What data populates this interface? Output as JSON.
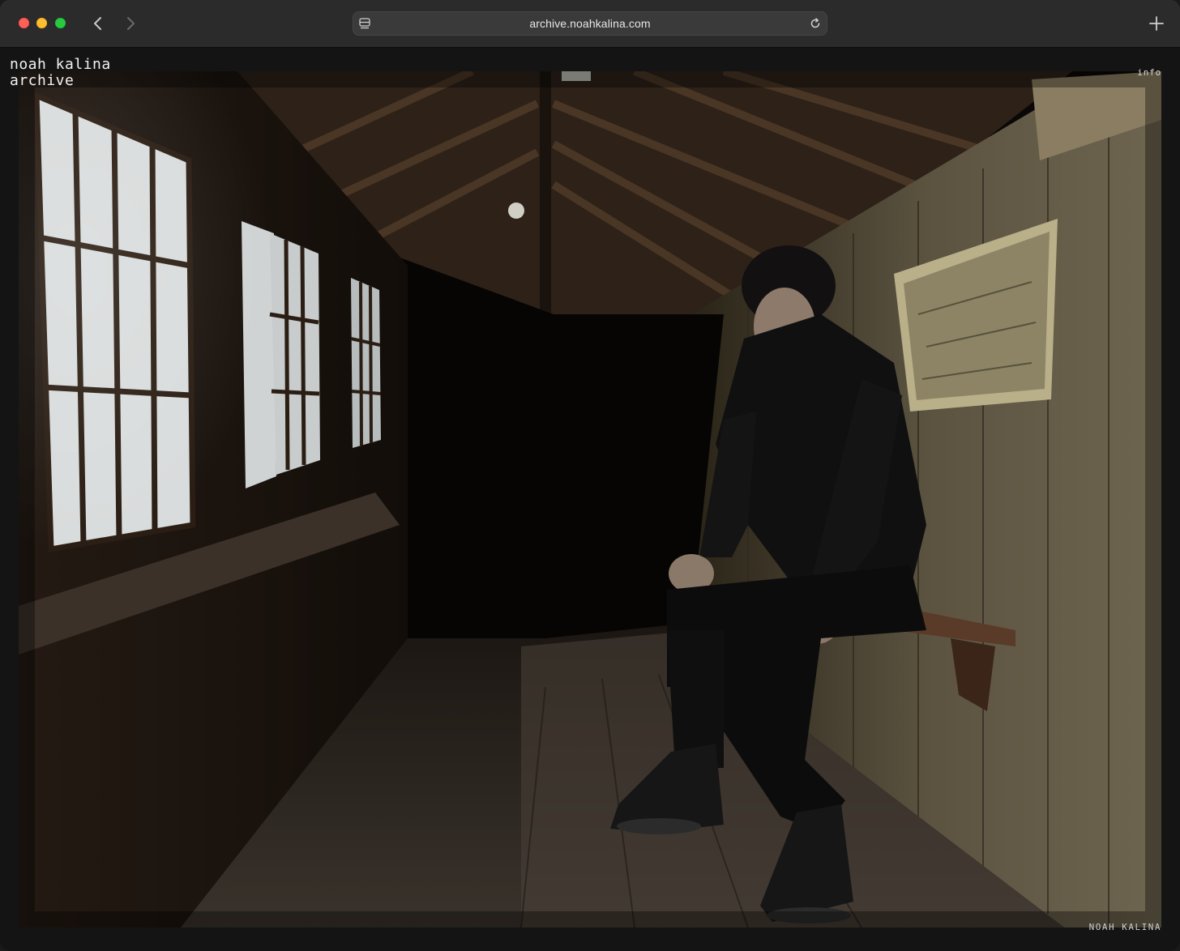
{
  "browser": {
    "url": "archive.noahkalina.com",
    "icons": {
      "back": "chevron-left-icon",
      "forward": "chevron-right-icon",
      "page": "page-menu-icon",
      "reload": "reload-icon",
      "new_tab": "plus-icon"
    }
  },
  "site": {
    "title_line1": "noah kalina",
    "title_line2": "archive",
    "info_link": "info",
    "photo_credit": "NOAH KALINA"
  },
  "colors": {
    "chrome_bg": "#2b2b2b",
    "address_bg": "#3a3a3a",
    "page_bg": "#141414",
    "text": "#f2f2f2"
  }
}
